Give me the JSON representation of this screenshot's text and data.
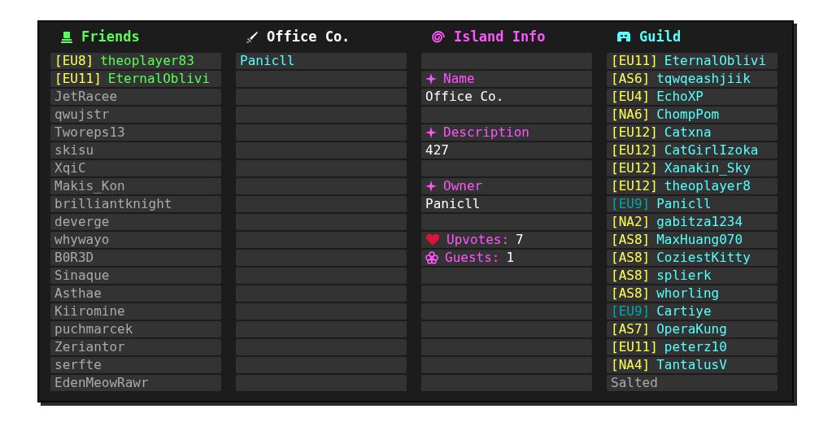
{
  "friends": {
    "title": "Friends",
    "items": [
      {
        "server": "[EU8]",
        "name": "theoplayer83",
        "online": true,
        "color": "#ffff55"
      },
      {
        "server": "[EU11]",
        "name": "EternalOblivi",
        "online": true,
        "color": "#ffff55"
      },
      {
        "name": "JetRacee",
        "online": false
      },
      {
        "name": "qwujstr",
        "online": false
      },
      {
        "name": "Tworeps13",
        "online": false
      },
      {
        "name": "skisu",
        "online": false
      },
      {
        "name": "XqiC",
        "online": false
      },
      {
        "name": "Makis_Kon",
        "online": false
      },
      {
        "name": "brilliantknight",
        "online": false
      },
      {
        "name": "deverge",
        "online": false
      },
      {
        "name": "whywayo",
        "online": false
      },
      {
        "name": "B0R3D",
        "online": false
      },
      {
        "name": "Sinaque",
        "online": false
      },
      {
        "name": "Asthae",
        "online": false
      },
      {
        "name": "Kiiromine",
        "online": false
      },
      {
        "name": "puchmarcek",
        "online": false
      },
      {
        "name": "Zeriantor",
        "online": false
      },
      {
        "name": "serfte",
        "online": false
      },
      {
        "name": "EdenMeowRawr",
        "online": false
      }
    ]
  },
  "island": {
    "title": "Office Co.",
    "members": [
      {
        "name": "Panicll"
      }
    ]
  },
  "island_info": {
    "title": "Island Info",
    "rows": [
      {
        "kind": "blank"
      },
      {
        "kind": "heading",
        "text": "Name"
      },
      {
        "kind": "value",
        "text": "Office Co."
      },
      {
        "kind": "blank"
      },
      {
        "kind": "heading",
        "text": "Description"
      },
      {
        "kind": "value",
        "text": "427"
      },
      {
        "kind": "blank"
      },
      {
        "kind": "heading",
        "text": "Owner"
      },
      {
        "kind": "value",
        "text": "Panicll"
      },
      {
        "kind": "blank"
      },
      {
        "kind": "upvotes",
        "label": "Upvotes:",
        "value": "7"
      },
      {
        "kind": "guests",
        "label": "Guests:",
        "value": "1"
      }
    ]
  },
  "guild": {
    "title": "Guild",
    "items": [
      {
        "server": "[EU11]",
        "name": "EternalOblivi",
        "online": true,
        "color": "#ffff55"
      },
      {
        "server": "[AS6]",
        "name": "tqwqeashjiik",
        "online": true,
        "color": "#ffff55"
      },
      {
        "server": "[EU4]",
        "name": "EchoXP",
        "online": true,
        "color": "#ffff55"
      },
      {
        "server": "[NA6]",
        "name": "ChompPom",
        "online": true,
        "color": "#ffff55"
      },
      {
        "server": "[EU12]",
        "name": "Catxna",
        "online": true,
        "color": "#ffff55"
      },
      {
        "server": "[EU12]",
        "name": "CatGirlIzoka",
        "online": true,
        "color": "#ffff55"
      },
      {
        "server": "[EU12]",
        "name": "Xanakin_Sky",
        "online": true,
        "color": "#ffff55"
      },
      {
        "server": "[EU12]",
        "name": "theoplayer8",
        "online": true,
        "color": "#ffff55"
      },
      {
        "server": "[EU9]",
        "name": "Panicll",
        "online": true,
        "color": "#00aaaa"
      },
      {
        "server": "[NA2]",
        "name": "gabitza1234",
        "online": true,
        "color": "#ffff55"
      },
      {
        "server": "[AS8]",
        "name": "MaxHuang070",
        "online": true,
        "color": "#ffff55"
      },
      {
        "server": "[AS8]",
        "name": "CoziestKitty",
        "online": true,
        "color": "#ffff55"
      },
      {
        "server": "[AS8]",
        "name": "splierk",
        "online": true,
        "color": "#ffff55"
      },
      {
        "server": "[AS8]",
        "name": "whorling",
        "online": true,
        "color": "#ffff55"
      },
      {
        "server": "[EU9]",
        "name": "Cartiye",
        "online": true,
        "color": "#00aaaa"
      },
      {
        "server": "[AS7]",
        "name": "OperaKung",
        "online": true,
        "color": "#ffff55"
      },
      {
        "server": "[EU11]",
        "name": "peterz10",
        "online": true,
        "color": "#ffff55"
      },
      {
        "server": "[NA4]",
        "name": "TantalusV",
        "online": true,
        "color": "#ffff55"
      },
      {
        "name": "Salted",
        "online": false
      }
    ]
  }
}
